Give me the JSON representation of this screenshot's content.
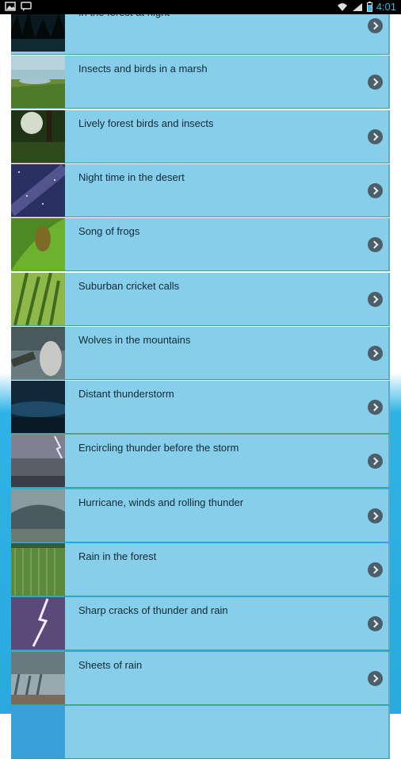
{
  "status_bar": {
    "time": "4:01",
    "left_icons": [
      "image-icon",
      "chat-icon"
    ],
    "right_icons": [
      "wifi-icon",
      "signal-icon",
      "battery-icon"
    ]
  },
  "sounds": [
    {
      "label": "In the forest at night",
      "thumb": "forest-night"
    },
    {
      "label": "Insects and birds in a marsh",
      "thumb": "marsh"
    },
    {
      "label": "Lively forest birds and insects",
      "thumb": "forest-sun"
    },
    {
      "label": "Night time in the desert",
      "thumb": "night-sky"
    },
    {
      "label": "Song of frogs",
      "thumb": "frog-leaf"
    },
    {
      "label": "Suburban cricket calls",
      "thumb": "grass"
    },
    {
      "label": "Wolves in the mountains",
      "thumb": "wolf"
    },
    {
      "label": "Distant thunderstorm",
      "thumb": "storm-dark"
    },
    {
      "label": "Encircling thunder before the storm",
      "thumb": "lightning-gray"
    },
    {
      "label": "Hurricane, winds and rolling thunder",
      "thumb": "shelf-cloud"
    },
    {
      "label": "Rain in the forest",
      "thumb": "rain-forest"
    },
    {
      "label": "Sharp cracks of thunder and rain",
      "thumb": "lightning-purple"
    },
    {
      "label": "Sheets of rain",
      "thumb": "rain-sheets"
    },
    {
      "label": "",
      "thumb": "next"
    }
  ]
}
